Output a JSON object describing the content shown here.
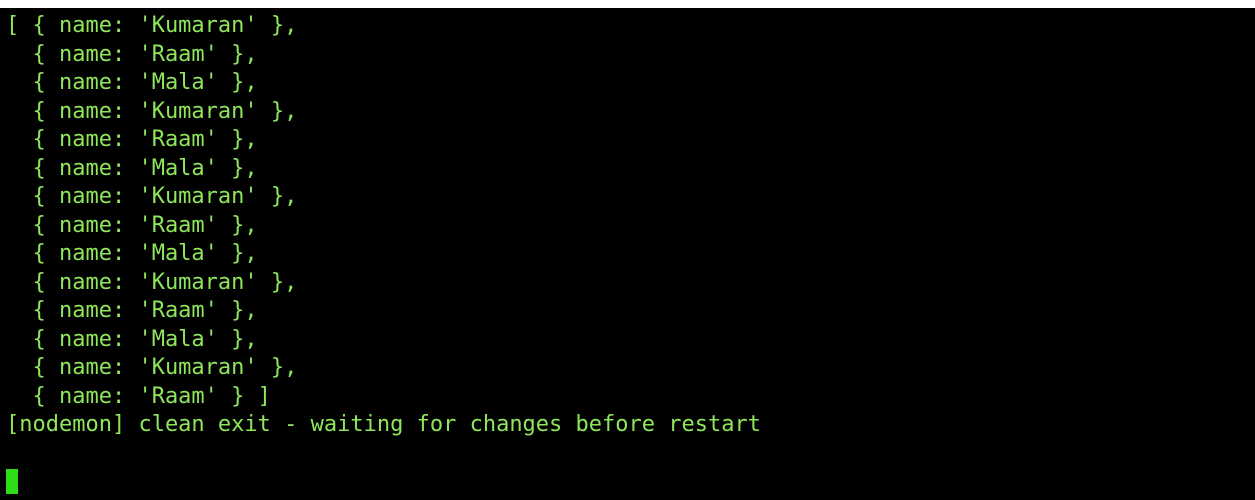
{
  "colors": {
    "background": "#000000",
    "text": "#8ee65b",
    "cursor": "#2fdc1a"
  },
  "terminal": {
    "lines": [
      "[ { name: 'Kumaran' },",
      "  { name: 'Raam' },",
      "  { name: 'Mala' },",
      "  { name: 'Kumaran' },",
      "  { name: 'Raam' },",
      "  { name: 'Mala' },",
      "  { name: 'Kumaran' },",
      "  { name: 'Raam' },",
      "  { name: 'Mala' },",
      "  { name: 'Kumaran' },",
      "  { name: 'Raam' },",
      "  { name: 'Mala' },",
      "  { name: 'Kumaran' },",
      "  { name: 'Raam' } ]",
      "[nodemon] clean exit - waiting for changes before restart"
    ]
  }
}
